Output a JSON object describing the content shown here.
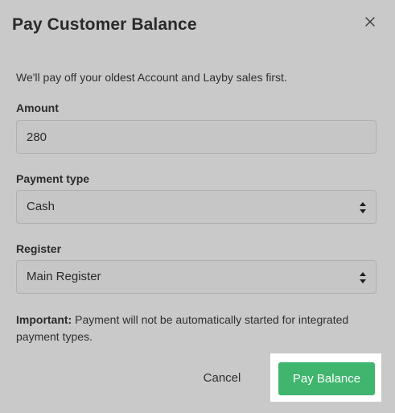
{
  "dialog": {
    "title": "Pay Customer Balance",
    "subtitle": "We'll pay off your oldest Account and Layby sales first.",
    "amount": {
      "label": "Amount",
      "value": "280"
    },
    "payment_type": {
      "label": "Payment type",
      "selected": "Cash"
    },
    "register": {
      "label": "Register",
      "selected": "Main Register"
    },
    "note": {
      "strong": "Important:",
      "text": " Payment will not be automatically started for integrated payment types."
    },
    "buttons": {
      "cancel": "Cancel",
      "pay": "Pay Balance"
    },
    "colors": {
      "pay_button": "#3fb56e",
      "background": "#c9c9c9"
    }
  }
}
